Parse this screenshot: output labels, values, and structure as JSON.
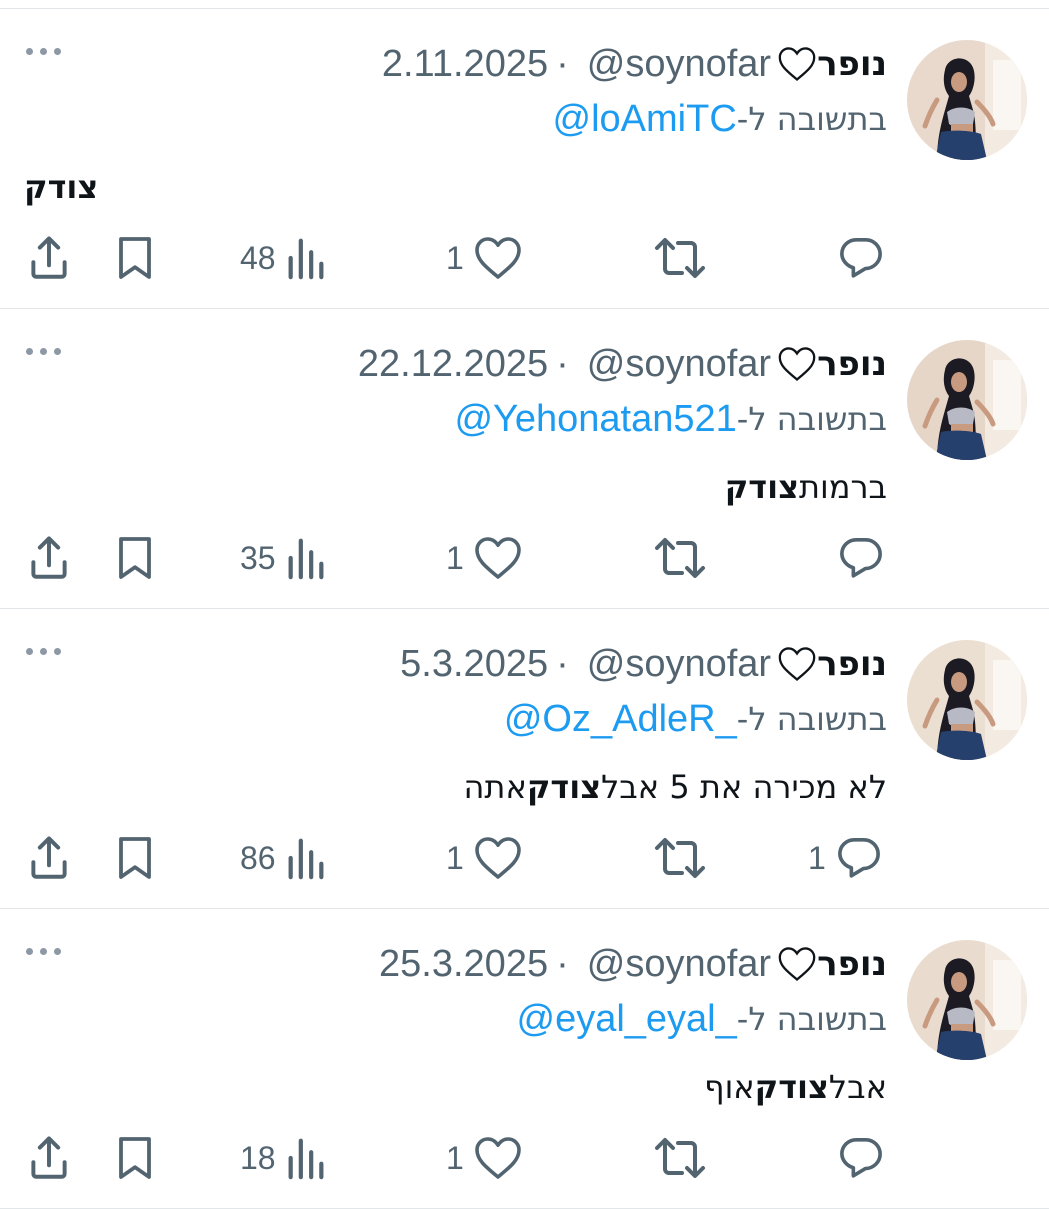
{
  "tweets": [
    {
      "display_name": "נופר",
      "handle": "@soynofar",
      "separator": "·",
      "date": "2.11.2025",
      "reply_prefix": "בתשובה ל-",
      "reply_to": "@loAmiTC",
      "text_before": "",
      "text_bold": "צודק",
      "text_after": "",
      "replies": "",
      "retweets": "",
      "likes": "1",
      "views": "48"
    },
    {
      "display_name": "נופר",
      "handle": "@soynofar",
      "separator": "·",
      "date": "22.12.2025",
      "reply_prefix": "בתשובה ל-",
      "reply_to": "@Yehonatan521",
      "text_before": "",
      "text_bold": "צודק",
      "text_after": " ברמות",
      "replies": "",
      "retweets": "",
      "likes": "1",
      "views": "35"
    },
    {
      "display_name": "נופר",
      "handle": "@soynofar",
      "separator": "·",
      "date": "5.3.2025",
      "reply_prefix": "בתשובה ל-",
      "reply_to": "@Oz_AdleR_",
      "text_before": "אתה ",
      "text_bold": "צודק",
      "text_after": " לא מכירה את 5 אבל",
      "replies": "1",
      "retweets": "",
      "likes": "1",
      "views": "86"
    },
    {
      "display_name": "נופר",
      "handle": "@soynofar",
      "separator": "·",
      "date": "25.3.2025",
      "reply_prefix": "בתשובה ל-",
      "reply_to": "@eyal_eyal_",
      "text_before": "אוף ",
      "text_bold": "צודק",
      "text_after": " אבל",
      "replies": "",
      "retweets": "",
      "likes": "1",
      "views": "18"
    }
  ],
  "icons": {
    "more": "more-dots-icon",
    "reply": "reply-bubble-icon",
    "retweet": "retweet-icon",
    "like": "heart-icon",
    "views": "views-bar-chart-icon",
    "bookmark": "bookmark-icon",
    "share": "share-icon",
    "name_heart": "white-heart-icon"
  },
  "colors": {
    "text": "#0f1419",
    "secondary": "#536471",
    "link": "#1d9bf0",
    "divider": "#e3e6e9"
  }
}
